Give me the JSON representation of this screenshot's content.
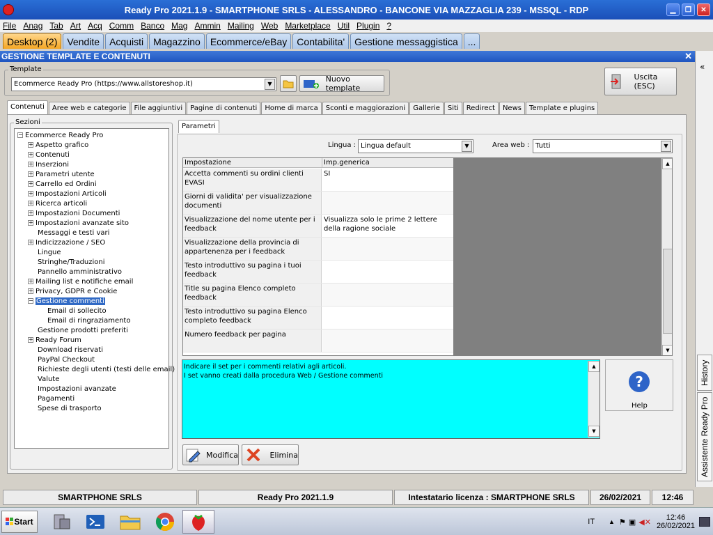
{
  "window": {
    "title": "Ready Pro 2021.1.9 - SMARTPHONE SRLS - ALESSANDRO - BANCONE VIA MAZZAGLIA 239 - MSSQL - RDP"
  },
  "menu": [
    "File",
    "Anag",
    "Tab",
    "Art",
    "Acq",
    "Comm",
    "Banco",
    "Mag",
    "Ammin",
    "Mailing",
    "Web",
    "Marketplace",
    "Util",
    "Plugin",
    "?"
  ],
  "desktop_tabs": [
    "Desktop (2)",
    "Vendite",
    "Acquisti",
    "Magazzino",
    "Ecommerce/eBay",
    "Contabilita'",
    "Gestione messaggistica",
    "..."
  ],
  "panel": {
    "title": "GESTIONE TEMPLATE E CONTENUTI",
    "close": "✕"
  },
  "template": {
    "group_label": "Template",
    "selected": "Ecommerce Ready Pro (https://www.allstoreshop.it)",
    "new_button": "Nuovo template",
    "exit_button": "Uscita (ESC)"
  },
  "subtabs": [
    "Contenuti",
    "Aree web e categorie",
    "File aggiuntivi",
    "Pagine di contenuti",
    "Home di marca",
    "Sconti e maggiorazioni",
    "Gallerie",
    "Siti",
    "Redirect",
    "News",
    "Template e plugins"
  ],
  "sections": {
    "label": "Sezioni",
    "root": "Ecommerce Ready Pro",
    "items": [
      {
        "label": "Aspetto grafico",
        "exp": "+"
      },
      {
        "label": "Contenuti",
        "exp": "+"
      },
      {
        "label": "Inserzioni",
        "exp": "+"
      },
      {
        "label": "Parametri utente",
        "exp": "+"
      },
      {
        "label": "Carrello ed Ordini",
        "exp": "+"
      },
      {
        "label": "Impostazioni Articoli",
        "exp": "+"
      },
      {
        "label": "Ricerca articoli",
        "exp": "+"
      },
      {
        "label": "Impostazioni Documenti",
        "exp": "+"
      },
      {
        "label": "Impostazioni avanzate sito",
        "exp": "+"
      },
      {
        "label": "Messaggi e testi vari",
        "exp": ""
      },
      {
        "label": "Indicizzazione / SEO",
        "exp": "+"
      },
      {
        "label": "Lingue",
        "exp": ""
      },
      {
        "label": "Stringhe/Traduzioni",
        "exp": ""
      },
      {
        "label": "Pannello amministrativo",
        "exp": ""
      },
      {
        "label": "Mailing list e notifiche email",
        "exp": "+"
      },
      {
        "label": "Privacy, GDPR e Cookie",
        "exp": "+"
      },
      {
        "label": "Gestione commenti",
        "exp": "−",
        "selected": true
      },
      {
        "label": "Email di sollecito",
        "exp": "",
        "child": true
      },
      {
        "label": "Email di ringraziamento",
        "exp": "",
        "child": true
      },
      {
        "label": "Gestione prodotti preferiti",
        "exp": ""
      },
      {
        "label": "Ready Forum",
        "exp": "+"
      },
      {
        "label": "Download riservati",
        "exp": ""
      },
      {
        "label": "PayPal Checkout",
        "exp": ""
      },
      {
        "label": "Richieste degli utenti (testi delle email)",
        "exp": ""
      },
      {
        "label": "Valute",
        "exp": ""
      },
      {
        "label": "Impostazioni avanzate",
        "exp": ""
      },
      {
        "label": "Pagamenti",
        "exp": ""
      },
      {
        "label": "Spese di trasporto",
        "exp": ""
      }
    ]
  },
  "params": {
    "tab": "Parametri",
    "lingua_label": "Lingua :",
    "lingua_value": "Lingua default",
    "area_label": "Area web :",
    "area_value": "Tutti",
    "col1": "Impostazione",
    "col2": "Imp.generica",
    "rows": [
      {
        "name": "Accetta commenti su ordini clienti EVASI",
        "value": "SI"
      },
      {
        "name": "Giorni di validita' per visualizzazione documenti",
        "value": ""
      },
      {
        "name": "Visualizzazione del nome utente per i feedback",
        "value": "Visualizza solo le prime 2 lettere della ragione sociale"
      },
      {
        "name": "Visualizzazione della provincia di appartenenza per i feedback",
        "value": ""
      },
      {
        "name": "Testo introduttivo su pagina i tuoi feedback",
        "value": ""
      },
      {
        "name": "Title su pagina Elenco completo feedback",
        "value": ""
      },
      {
        "name": "Testo introduttivo su pagina Elenco completo feedback",
        "value": ""
      },
      {
        "name": "Numero feedback per pagina",
        "value": ""
      }
    ]
  },
  "note": {
    "line1": "Indicare il set per i commenti relativi agli articoli.",
    "line2": "I set vanno creati dalla procedura Web / Gestione commenti"
  },
  "help_label": "Help",
  "actions": {
    "modify": "Modifica",
    "delete": "Elimina"
  },
  "side_tabs": [
    "History",
    "Assistente Ready Pro"
  ],
  "status": [
    "SMARTPHONE SRLS",
    "Ready Pro 2021.1.9",
    "Intestatario licenza : SMARTPHONE SRLS",
    "26/02/2021",
    "12:46"
  ],
  "taskbar": {
    "start": "Start",
    "lang": "IT",
    "time": "12:46",
    "date": "26/02/2021"
  }
}
